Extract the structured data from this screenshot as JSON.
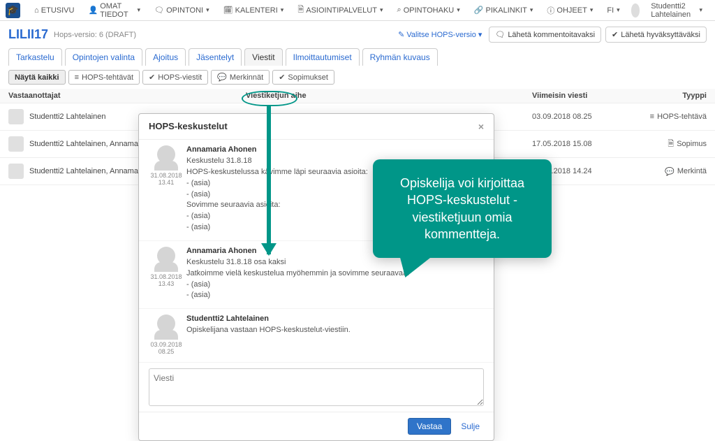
{
  "nav": {
    "items": [
      {
        "label": "ETUSIVU",
        "icon": "🏠"
      },
      {
        "label": "OMAT TIEDOT",
        "icon": "👤",
        "caret": true
      },
      {
        "label": "OPINTONI",
        "icon": "💬",
        "caret": true
      },
      {
        "label": "KALENTERI",
        "icon": "📅",
        "caret": true
      },
      {
        "label": "ASIOINTIPALVELUT",
        "icon": "📄",
        "caret": true
      },
      {
        "label": "OPINTOHAKU",
        "icon": "🔍",
        "caret": true
      },
      {
        "label": "PIKALINKIT",
        "icon": "🔗",
        "caret": true
      },
      {
        "label": "OHJEET",
        "icon": "ℹ",
        "caret": true
      }
    ],
    "lang": "FI",
    "user": "Studentti2 Lahtelainen"
  },
  "page": {
    "title": "LILII17",
    "subtitle": "Hops-versio: 6 (DRAFT)",
    "version_selector": "Valitse HOPS-versio",
    "btn_comment": "Lähetä kommentoitavaksi",
    "btn_approve": "Lähetä hyväksyttäväksi"
  },
  "tabs": [
    {
      "label": "Tarkastelu"
    },
    {
      "label": "Opintojen valinta"
    },
    {
      "label": "Ajoitus"
    },
    {
      "label": "Jäsentelyt"
    },
    {
      "label": "Viestit",
      "active": true
    },
    {
      "label": "Ilmoittautumiset"
    },
    {
      "label": "Ryhmän kuvaus"
    }
  ],
  "filters": [
    {
      "label": "Näytä kaikki",
      "active": true
    },
    {
      "label": "HOPS-tehtävät",
      "icon": "≡"
    },
    {
      "label": "HOPS-viestit",
      "icon": "✔"
    },
    {
      "label": "Merkinnät",
      "icon": "💬"
    },
    {
      "label": "Sopimukset",
      "icon": "✔"
    }
  ],
  "table": {
    "head": {
      "recipients": "Vastaanottajat",
      "topic": "Viestiketjun aihe",
      "latest": "Viimeisin viesti",
      "type": "Tyyppi"
    },
    "rows": [
      {
        "recip": "Studentti2 Lahtelainen",
        "topic": "HOPS-keskustelut",
        "date": "03.09.2018 08.25",
        "type": "HOPS-tehtävä",
        "type_icon": "≡"
      },
      {
        "recip": "Studentti2 Lahtelainen, Annamaria Ahonen",
        "topic": "",
        "date": "17.05.2018 15.08",
        "type": "Sopimus",
        "type_icon": "🗎"
      },
      {
        "recip": "Studentti2 Lahtelainen, Annamaria Ahonen",
        "topic": "",
        "date": "12.04.2018 14.24",
        "type": "Merkintä",
        "type_icon": "💬"
      }
    ]
  },
  "modal": {
    "title": "HOPS-keskustelut",
    "messages": [
      {
        "author": "Annamaria Ahonen",
        "ts": "31.08.2018 13.41",
        "lines": [
          "Keskustelu 31.8.18",
          "HOPS-keskustelussa kävimme läpi seuraavia asioita:",
          "- (asia)",
          "- (asia)",
          "Sovimme seuraavia asioita:",
          "- (asia)",
          "- (asia)"
        ]
      },
      {
        "author": "Annamaria Ahonen",
        "ts": "31.08.2018 13.43",
        "lines": [
          "Keskustelu 31.8.18 osa kaksi",
          "Jatkoimme vielä keskustelua myöhemmin ja sovimme seuraavaa:",
          "- (asia)",
          "- (asia)"
        ]
      },
      {
        "author": "Studentti2 Lahtelainen",
        "ts": "03.09.2018 08.25",
        "lines": [
          "Opiskelijana vastaan HOPS-keskustelut-viestiin."
        ]
      }
    ],
    "placeholder": "Viesti",
    "btn_reply": "Vastaa",
    "btn_close": "Sulje"
  },
  "callout": "Opiskelija voi kirjoittaa HOPS-keskustelut -viestiketjuun omia kommentteja.",
  "colors": {
    "accent": "#2a6ad0",
    "teal": "#009688"
  }
}
